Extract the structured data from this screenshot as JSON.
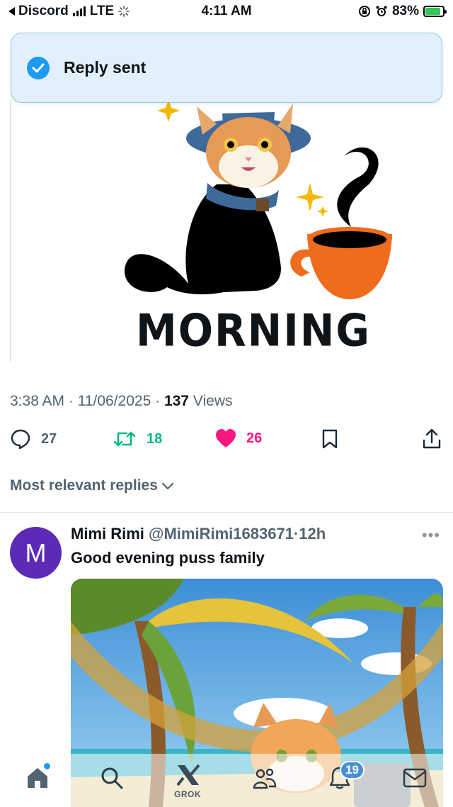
{
  "status_bar": {
    "back_app": "Discord",
    "network": "LTE",
    "time": "4:11 AM",
    "battery": "83%"
  },
  "toast": {
    "message": "Reply sent"
  },
  "post": {
    "image_caption": "MORNING",
    "time": "3:38 AM",
    "date": "11/06/2025",
    "views_count": "137",
    "views_label": "Views",
    "replies": "27",
    "reposts": "18",
    "likes": "26"
  },
  "replies_filter": {
    "label": "Most relevant replies"
  },
  "reply": {
    "avatar_letter": "M",
    "name": "Mimi Rimi",
    "handle": "@MimiRimi1683671",
    "age": "12h",
    "text": "Good evening puss family"
  },
  "bottom_nav": {
    "items": [
      "home-icon",
      "search-icon",
      "grok-icon",
      "communities-icon",
      "notifications-icon",
      "messages-icon"
    ],
    "grok_label": "GROK",
    "notifications_badge": "19"
  },
  "colors": {
    "accent": "#1d9bf0",
    "repost": "#00ba7c",
    "like": "#f91880",
    "secondary_text": "#536471",
    "avatar_bg": "#5b2bb6"
  }
}
